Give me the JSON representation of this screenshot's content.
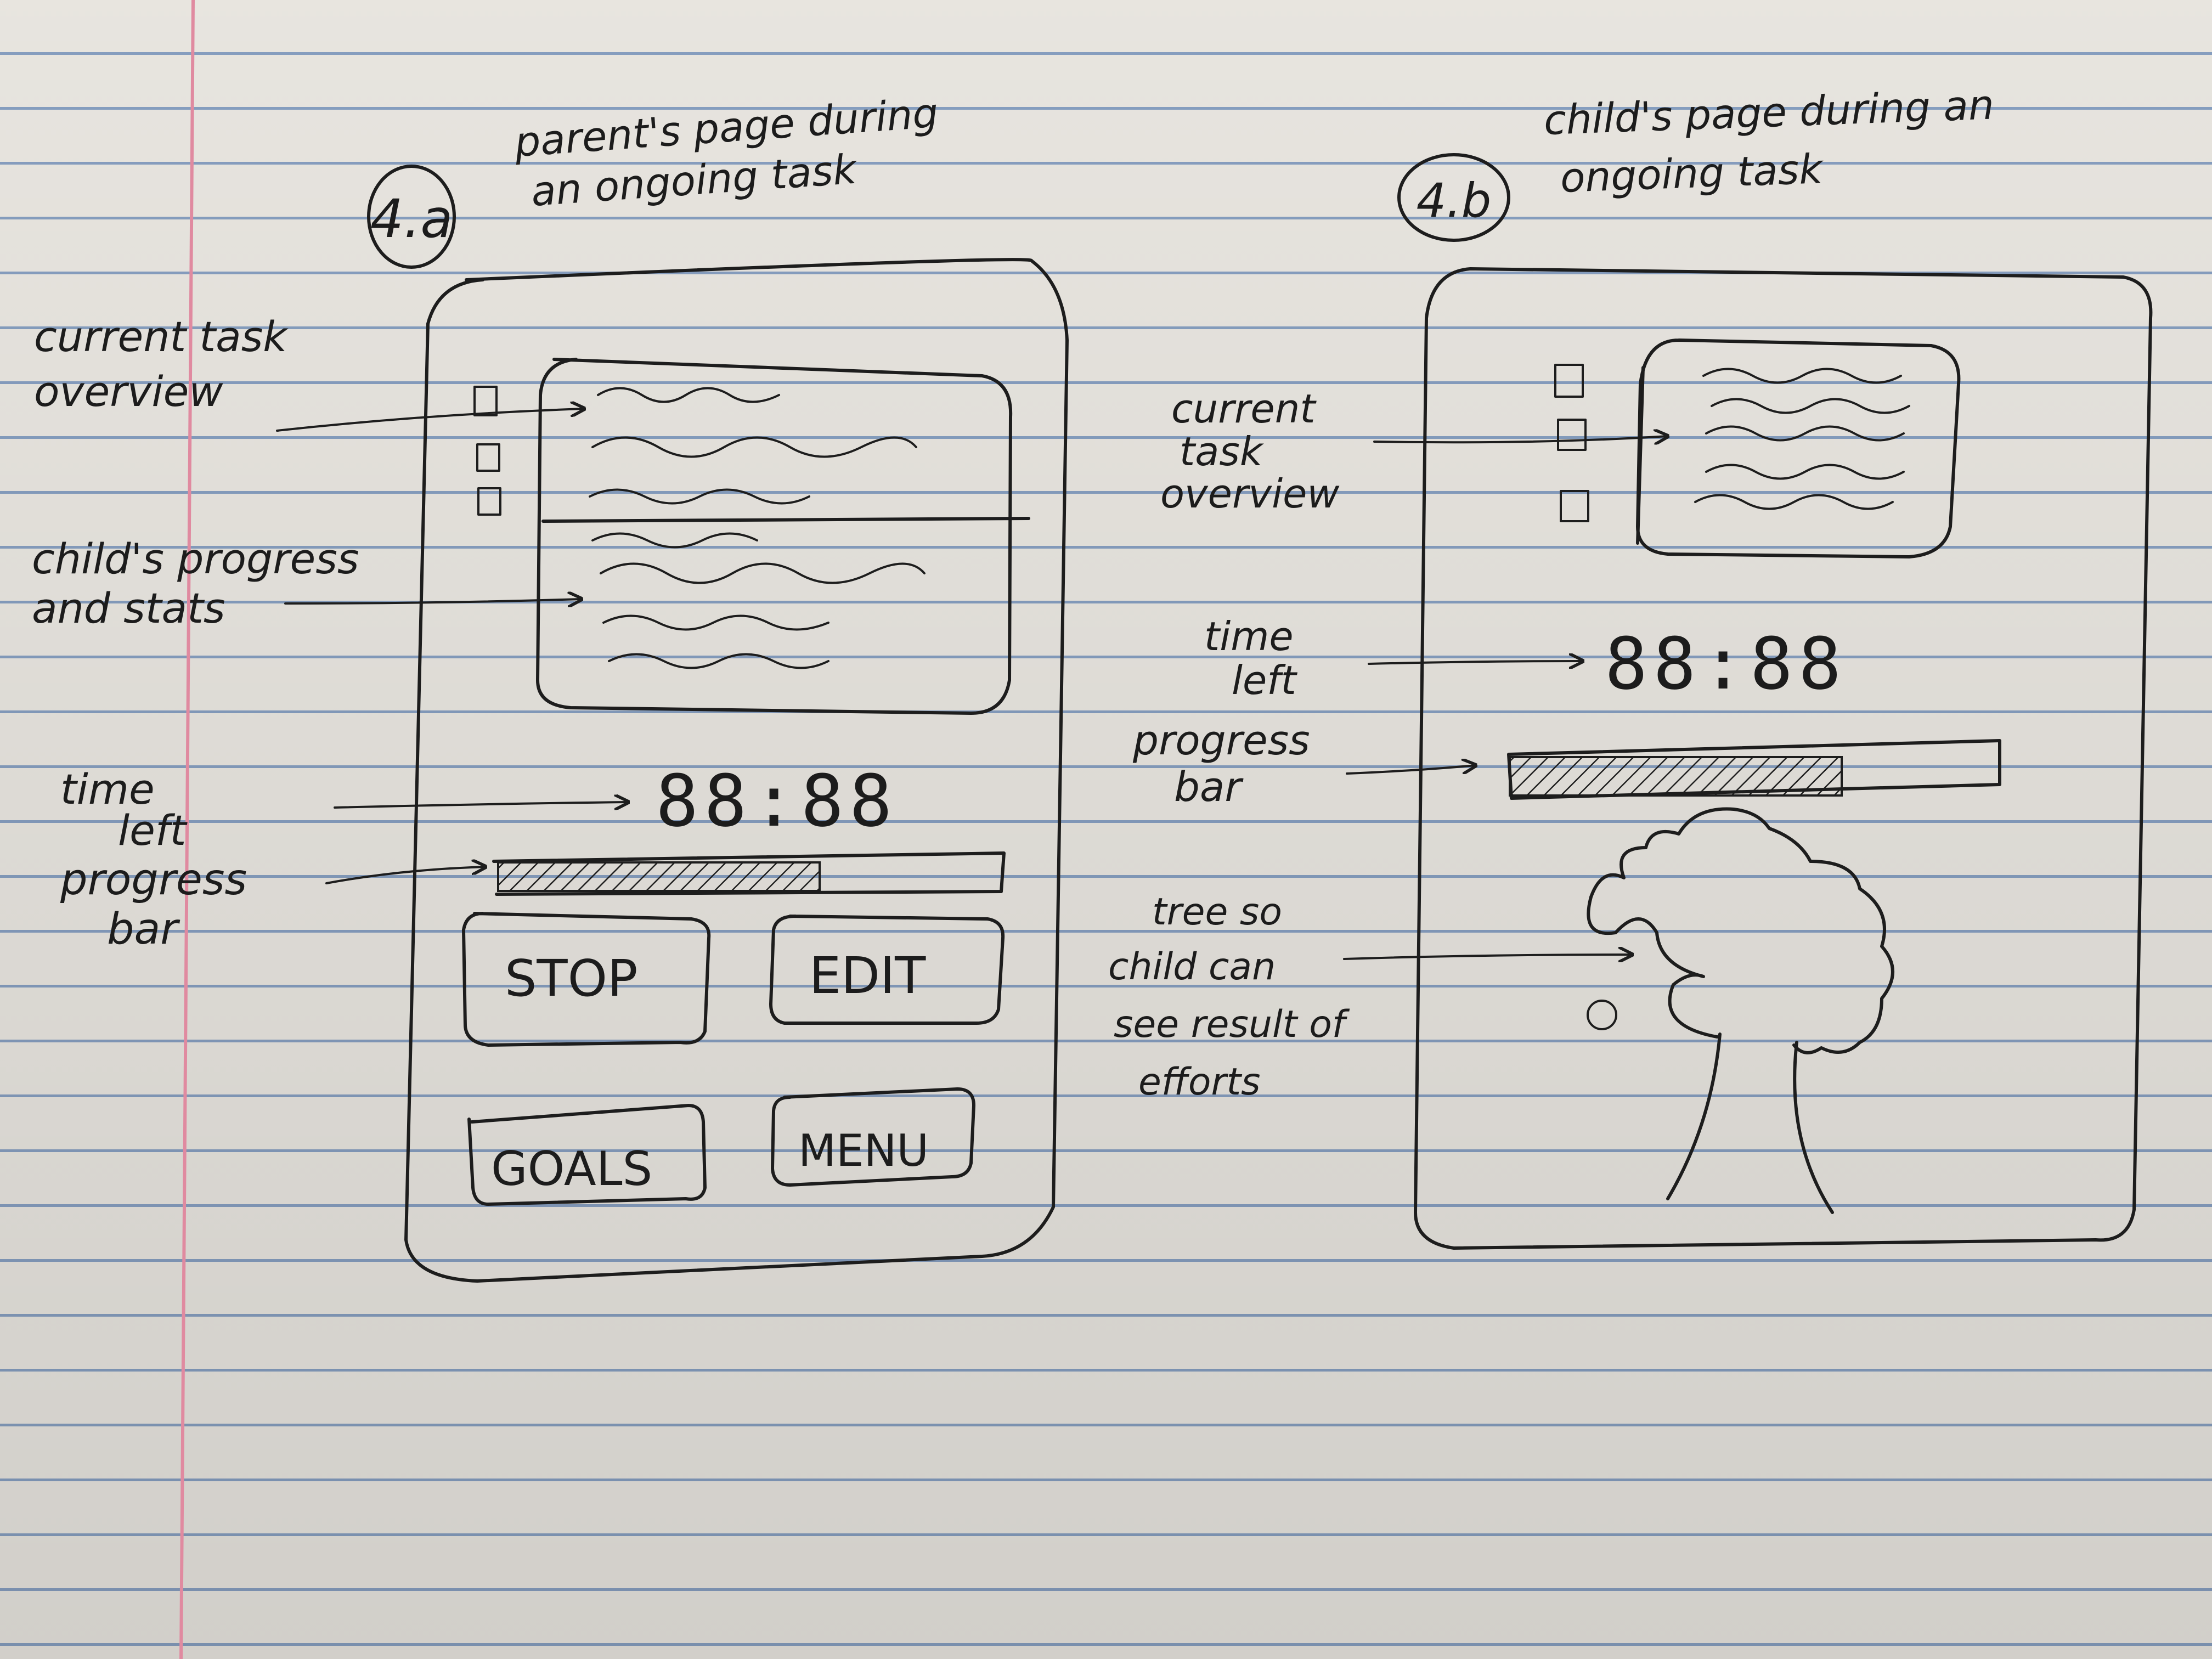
{
  "left": {
    "number": "4.a",
    "caption_1": "parent's page during",
    "caption_2": "an ongoing task",
    "annotations": {
      "overview_1": "current task",
      "overview_2": "overview",
      "progress_1": "child's progress",
      "progress_2": "and stats",
      "time_1": "time",
      "time_2": "left",
      "bar_1": "progress",
      "bar_2": "bar"
    },
    "timer": "88:88",
    "progress_fraction": 0.64,
    "buttons": {
      "stop": "STOP",
      "edit": "EDIT",
      "goals": "GOALS",
      "menu": "MENU"
    }
  },
  "right": {
    "number": "4.b",
    "caption_1": "child's page during an",
    "caption_2": "ongoing task",
    "annotations": {
      "overview_1": "current",
      "overview_2": "task",
      "overview_3": "overview",
      "time_1": "time",
      "time_2": "left",
      "bar_1": "progress",
      "bar_2": "bar",
      "tree_1": "tree so",
      "tree_2": "child can",
      "tree_3": "see result of",
      "tree_4": "efforts"
    },
    "timer": "88:88",
    "progress_fraction": 0.68
  },
  "colors": {
    "ink": "#1d1d1d",
    "paper": "#f4f1eb",
    "rule_line": "#8da6c9",
    "margin_line": "#e08aa0"
  }
}
